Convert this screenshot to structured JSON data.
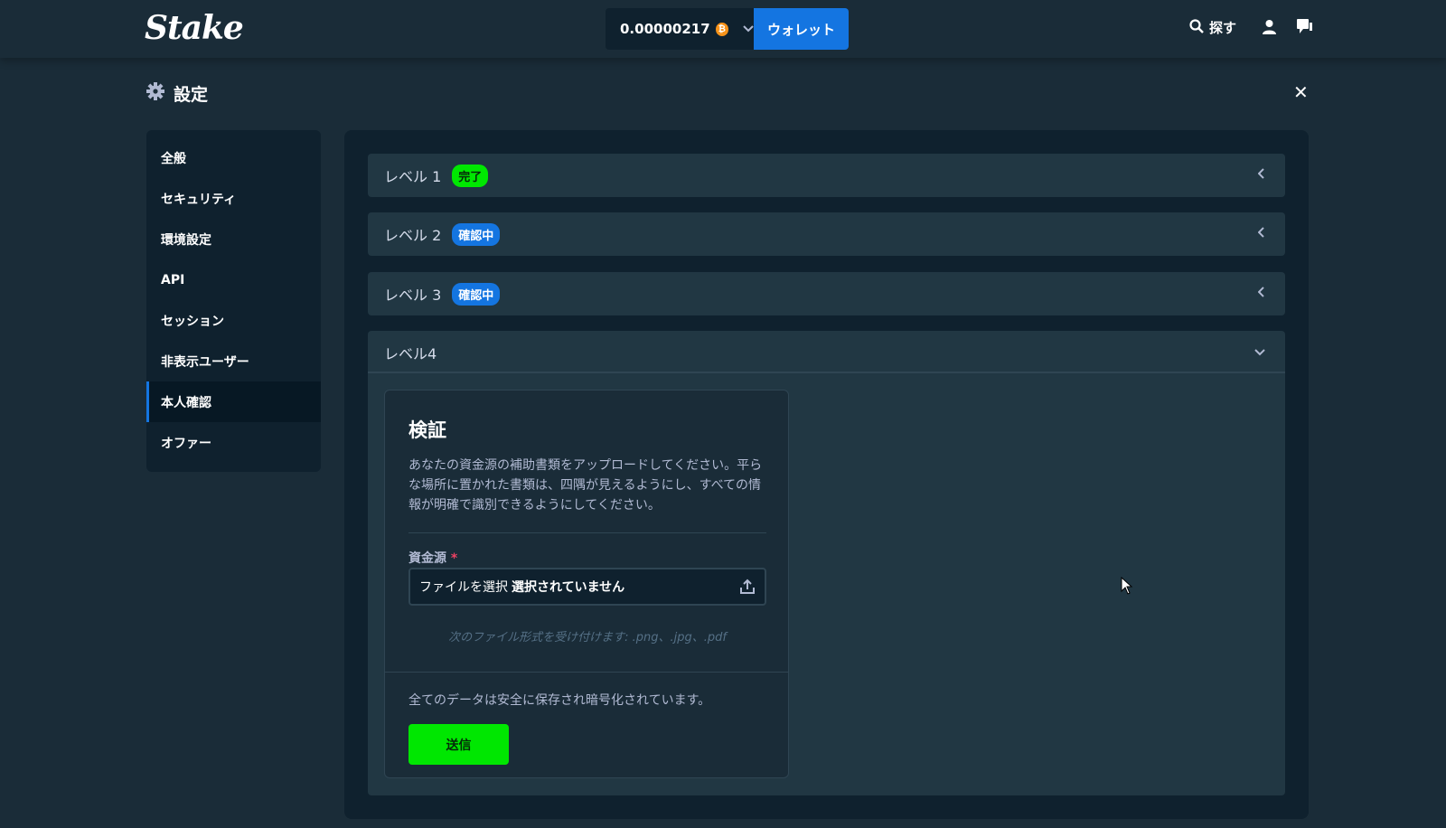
{
  "header": {
    "logo": "Stake",
    "balance": "0.00000217",
    "currency_icon": "bitcoin-icon",
    "wallet_label": "ウォレット",
    "search_label": "探す",
    "colors": {
      "background": "#1a2c38",
      "accent": "#1475e1",
      "success": "#00e701"
    }
  },
  "settings": {
    "title": "設定",
    "sidebar": [
      {
        "label": "全般"
      },
      {
        "label": "セキュリティ"
      },
      {
        "label": "環境設定"
      },
      {
        "label": "API"
      },
      {
        "label": "セッション"
      },
      {
        "label": "非表示ユーザー"
      },
      {
        "label": "本人確認",
        "active": true
      },
      {
        "label": "オファー"
      }
    ]
  },
  "levels": [
    {
      "label": "レベル 1",
      "badge": "完了"
    },
    {
      "label": "レベル 2",
      "badge": "確認中"
    },
    {
      "label": "レベル 3",
      "badge": "確認中"
    },
    {
      "label": "レベル4"
    }
  ],
  "verification": {
    "title": "検証",
    "description": "あなたの資金源の補助書類をアップロードしてください。平らな場所に置かれた書類は、四隅が見えるようにし、すべての情報が明確で識別できるようにしてください。",
    "field_label": "資金源",
    "required_mark": "*",
    "file_choose": "ファイルを選択",
    "file_none": "選択されていません",
    "hint": "次のファイル形式を受け付けます: .png、.jpg、.pdf",
    "secure_note": "全てのデータは安全に保存され暗号化されています。",
    "submit_label": "送信"
  }
}
